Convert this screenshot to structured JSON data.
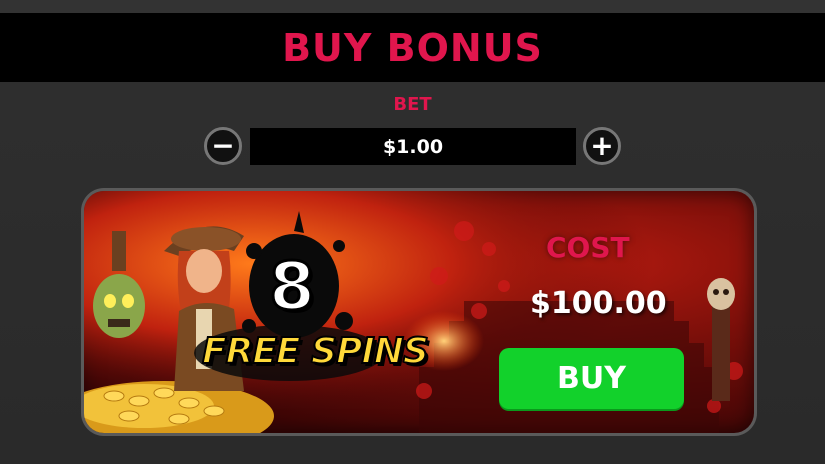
{
  "header": {
    "title": "BUY BONUS"
  },
  "bet": {
    "label": "BET",
    "value": "$1.00",
    "decrease_symbol": "−",
    "increase_symbol": "+"
  },
  "offer": {
    "count": "8",
    "feature": "FREE SPINS",
    "cost_label": "COST",
    "cost_value": "$100.00",
    "buy_label": "BUY"
  },
  "colors": {
    "accent": "#e0164d",
    "buy_green": "#12d12b",
    "free_spins_yellow": "#ffd93a"
  },
  "icons": [
    "minus-icon",
    "plus-icon",
    "zombie-head-icon",
    "skull-icon",
    "explorer-character-image",
    "gold-coins-image"
  ]
}
